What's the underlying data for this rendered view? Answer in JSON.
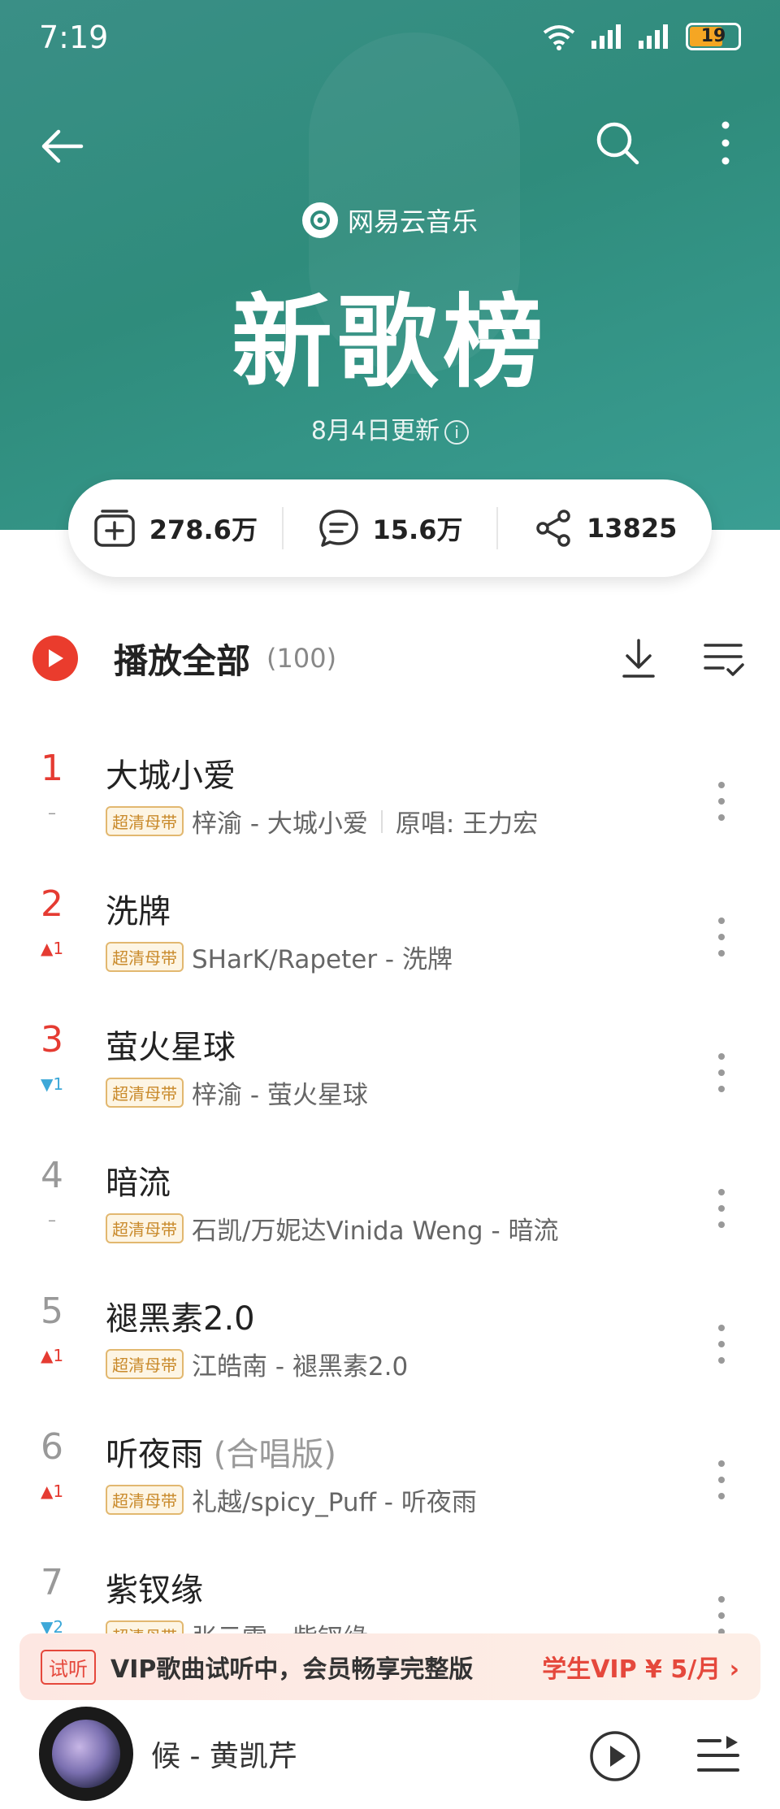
{
  "status_bar": {
    "time": "7:19",
    "battery": "19"
  },
  "header": {
    "brand": "网易云音乐",
    "title": "新歌榜",
    "update": "8月4日更新",
    "info_glyph": "i"
  },
  "stats": {
    "collect": "278.6万",
    "comments": "15.6万",
    "shares": "13825"
  },
  "playall": {
    "label": "播放全部",
    "count": "(100)"
  },
  "badge_label": "超清母带",
  "songs": [
    {
      "rank": "1",
      "change": "–",
      "title": "大城小爱",
      "title_sub": "",
      "artist_album": "梓渝 - 大城小爱",
      "extra": "原唱: 王力宏"
    },
    {
      "rank": "2",
      "change": "▲1",
      "title": "洗牌",
      "title_sub": "",
      "artist_album": "SHarK/Rapeter - 洗牌",
      "extra": ""
    },
    {
      "rank": "3",
      "change": "▼1",
      "title": "萤火星球",
      "title_sub": "",
      "artist_album": "梓渝 - 萤火星球",
      "extra": ""
    },
    {
      "rank": "4",
      "change": "–",
      "title": "暗流",
      "title_sub": "",
      "artist_album": "石凯/万妮达Vinida Weng - 暗流",
      "extra": ""
    },
    {
      "rank": "5",
      "change": "▲1",
      "title": "褪黑素2.0",
      "title_sub": "",
      "artist_album": "江皓南 - 褪黑素2.0",
      "extra": ""
    },
    {
      "rank": "6",
      "change": "▲1",
      "title": "听夜雨",
      "title_sub": " (合唱版)",
      "artist_album": "礼越/spicy_Puff - 听夜雨",
      "extra": ""
    },
    {
      "rank": "7",
      "change": "▼2",
      "title": "紫钗缘",
      "title_sub": "",
      "artist_album": "张云雷 - 紫钗缘",
      "extra": ""
    }
  ],
  "vip_bar": {
    "tag": "试听",
    "text": "VIP歌曲试听中，会员畅享完整版",
    "cta": "学生VIP ¥ 5/月 ›"
  },
  "player": {
    "now_playing": "候 - 黄凯芹"
  },
  "colors": {
    "header_bg": "#2f8c7c",
    "accent_red": "#e53b32",
    "down_blue": "#3da8d8",
    "badge_gold": "#c98a2b"
  },
  "icons": [
    "back-arrow-icon",
    "search-icon",
    "more-vertical-icon",
    "netease-logo-icon",
    "info-icon",
    "collect-add-icon",
    "comment-icon",
    "share-icon",
    "play-icon",
    "download-icon",
    "multi-select-icon",
    "playlist-icon"
  ]
}
